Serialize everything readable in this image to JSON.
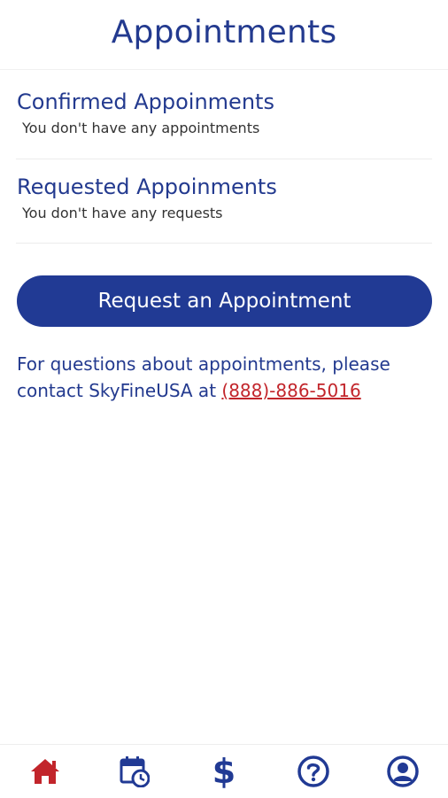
{
  "header": {
    "title": "Appointments"
  },
  "confirmed": {
    "title": "Confirmed Appoinments",
    "empty_text": "You don't have any appointments"
  },
  "requested": {
    "title": "Requested Appoinments",
    "empty_text": "You don't have any requests"
  },
  "request_button": {
    "label": "Request an Appointment"
  },
  "contact": {
    "text": "For questions about appointments, please contact SkyFineUSA at ",
    "phone": "(888)-886-5016"
  },
  "bottom_nav": {
    "items": [
      {
        "icon": "home-icon",
        "active": true
      },
      {
        "icon": "calendar-clock-icon",
        "active": false
      },
      {
        "icon": "dollar-icon",
        "symbol": "$",
        "active": false
      },
      {
        "icon": "help-icon",
        "active": false
      },
      {
        "icon": "profile-icon",
        "active": false
      }
    ]
  },
  "colors": {
    "primary": "#213a94",
    "accent_red": "#c2252b",
    "title_blue": "#233a8f"
  }
}
